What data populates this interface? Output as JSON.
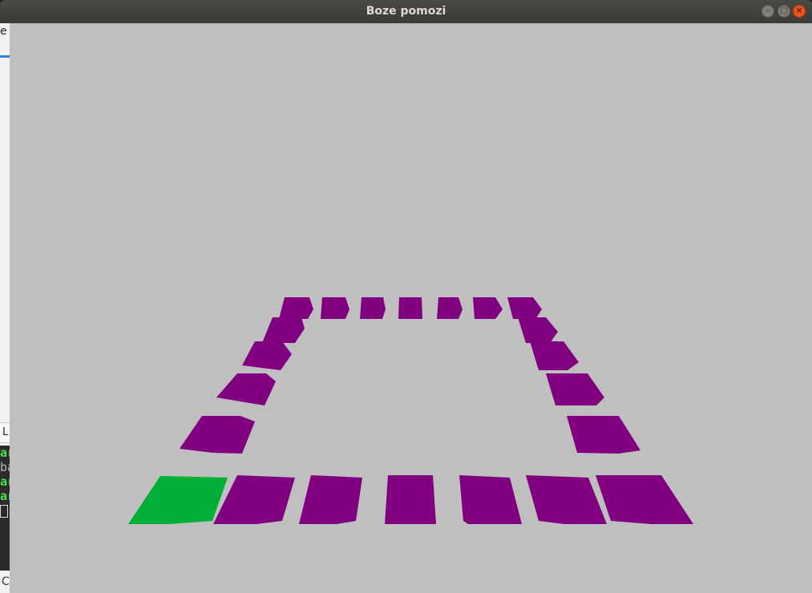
{
  "window": {
    "title": "Boze pomozi"
  },
  "background_apps": {
    "menu_fragment": "e",
    "panel_tab_fragment": "L",
    "terminal_lines": [
      {
        "text": "ar",
        "style": "green"
      },
      {
        "text": "ba",
        "style": "white"
      },
      {
        "text": "ar",
        "style": "green"
      },
      {
        "text": "ar",
        "style": "green"
      }
    ],
    "bottom_fragment": "C"
  },
  "colors": {
    "canvas_background": "#bfbfbf",
    "tile_default": "#800080",
    "tile_highlight": "#00b036",
    "titlebar": "#3c3b37",
    "close_button": "#e9541f"
  },
  "board": {
    "tile_count": 24,
    "highlighted_tile_index": 0,
    "highlighted_tile_state": "current-position"
  }
}
